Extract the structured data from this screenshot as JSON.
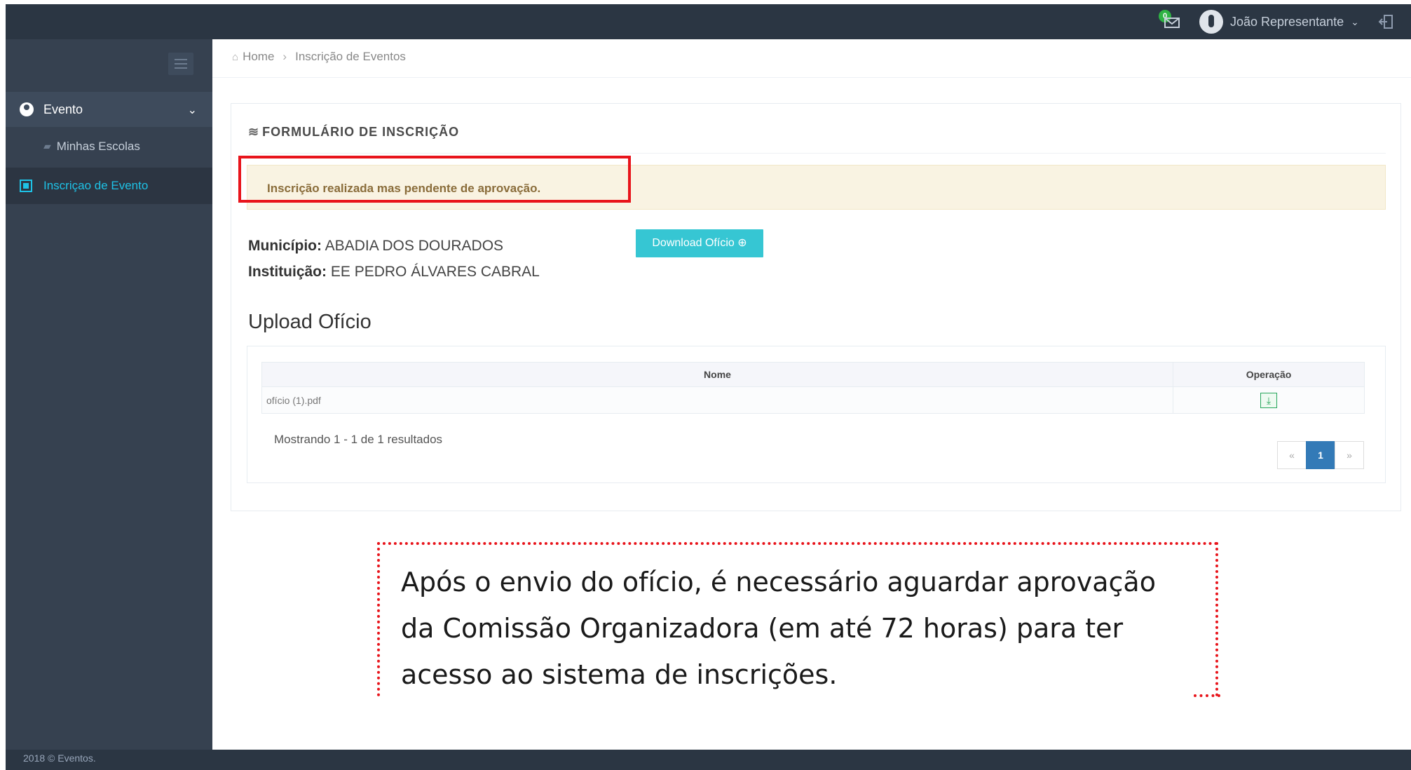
{
  "topbar": {
    "notification_count": "0",
    "user_name": "João Representante"
  },
  "sidebar": {
    "menu_evento": "Evento",
    "menu_escolas": "Minhas Escolas",
    "menu_inscricao": "Inscriçao de Evento",
    "footer": "2018 © Eventos."
  },
  "breadcrumb": {
    "home": "Home",
    "current": "Inscrição de Eventos"
  },
  "form": {
    "title": "FORMULÁRIO DE INSCRIÇÃO",
    "alert": "Inscrição realizada mas pendente de aprovação.",
    "municipio_label": "Município:",
    "municipio_value": "ABADIA DOS DOURADOS",
    "instituicao_label": "Instituição:",
    "instituicao_value": "EE PEDRO ÁLVARES CABRAL",
    "download_button": "Download Ofício"
  },
  "upload": {
    "title": "Upload Ofício",
    "columns": [
      "Nome",
      "Operação"
    ],
    "rows": [
      {
        "name": "ofício (1).pdf"
      }
    ],
    "result_text": "Mostrando 1 - 1 de 1 resultados",
    "pager": {
      "prev": "«",
      "current": "1",
      "next": "»"
    }
  },
  "callout": {
    "text": "Após o envio do ofício, é necessário aguardar aprovação da Comissão Organizadora (em até 72 horas) para ter acesso ao sistema de inscrições."
  },
  "colors": {
    "topbar": "#2b3643",
    "sidebar": "#364150",
    "accent": "#36c6d3",
    "highlight": "#e8141b",
    "alert_bg": "#f9f3e2"
  }
}
